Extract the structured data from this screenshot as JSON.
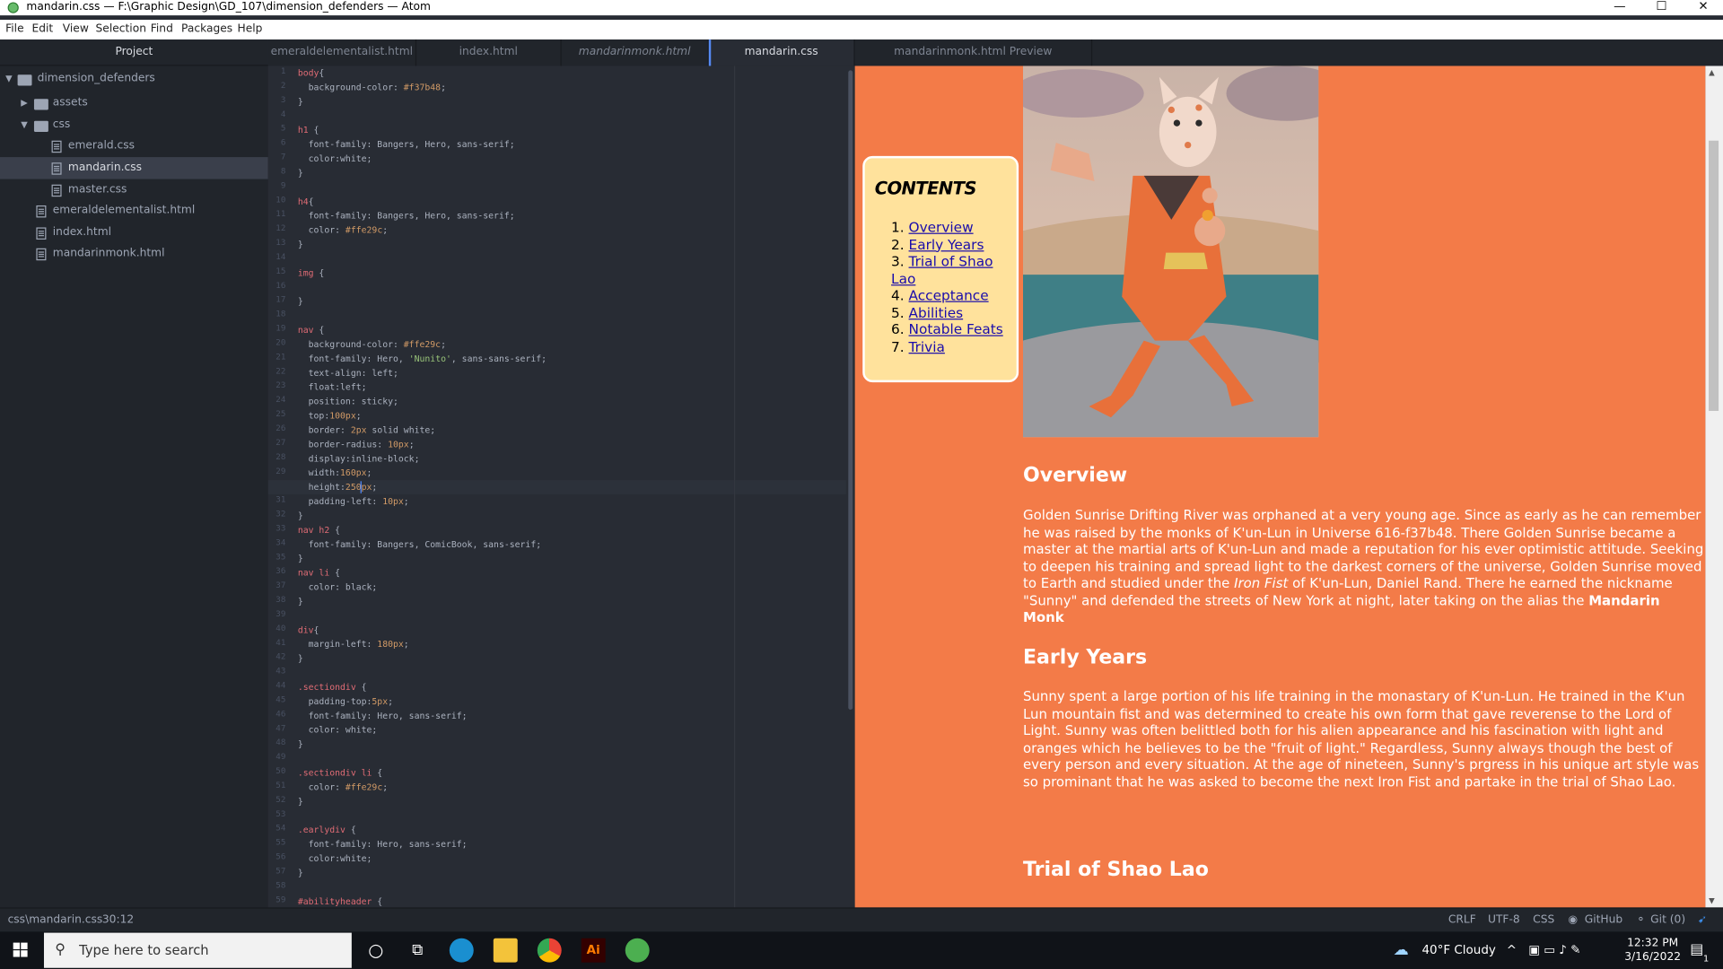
{
  "window": {
    "title": "mandarin.css — F:\\Graphic Design\\GD_107\\dimension_defenders — Atom",
    "minimize_glyph": "—",
    "maximize_glyph": "☐",
    "close_glyph": "✕"
  },
  "menu": [
    "File",
    "Edit",
    "View",
    "Selection",
    "Find",
    "Packages",
    "Help"
  ],
  "tree": {
    "header": "Project",
    "items": [
      {
        "label": "dimension_defenders",
        "type": "folder",
        "open": true,
        "depth": 0
      },
      {
        "label": "assets",
        "type": "folder",
        "open": false,
        "depth": 1
      },
      {
        "label": "css",
        "type": "folder",
        "open": true,
        "depth": 1
      },
      {
        "label": "emerald.css",
        "type": "file",
        "depth": 2
      },
      {
        "label": "mandarin.css",
        "type": "file",
        "depth": 2,
        "selected": true
      },
      {
        "label": "master.css",
        "type": "file",
        "depth": 2
      },
      {
        "label": "emeraldelementalist.html",
        "type": "file",
        "depth": 1
      },
      {
        "label": "index.html",
        "type": "file",
        "depth": 1
      },
      {
        "label": "mandarinmonk.html",
        "type": "file",
        "depth": 1
      }
    ]
  },
  "tabs": [
    {
      "label": "emeraldelementalist.html",
      "active": false,
      "italic": false
    },
    {
      "label": "index.html",
      "active": false,
      "italic": false
    },
    {
      "label": "mandarinmonk.html",
      "active": false,
      "italic": true
    },
    {
      "label": "mandarin.css",
      "active": true,
      "italic": false
    },
    {
      "label": "mandarinmonk.html Preview",
      "active": false,
      "italic": false
    }
  ],
  "editor": {
    "current_line": 30,
    "lines": [
      "body{",
      "  background-color: #f37b48;",
      "}",
      "",
      "h1 {",
      "  font-family: Bangers, Hero, sans-serif;",
      "  color:white;",
      "}",
      "",
      "h4{",
      "  font-family: Bangers, Hero, sans-serif;",
      "  color: #ffe29c;",
      "}",
      "",
      "img {",
      "",
      "}",
      "",
      "nav {",
      "  background-color: #ffe29c;",
      "  font-family: Hero, 'Nunito', sans-sans-serif;",
      "  text-align: left;",
      "  float:left;",
      "  position: sticky;",
      "  top:100px;",
      "  border: 2px solid white;",
      "  border-radius: 10px;",
      "  display:inline-block;",
      "  width:160px;",
      "  height:250px;",
      "  padding-left: 10px;",
      "}",
      "nav h2 {",
      "  font-family: Bangers, ComicBook, sans-serif;",
      "}",
      "nav li {",
      "  color: black;",
      "}",
      "",
      "div{",
      "  margin-left: 180px;",
      "}",
      "",
      ".sectiondiv {",
      "  padding-top:5px;",
      "  font-family: Hero, sans-serif;",
      "  color: white;",
      "}",
      "",
      ".sectiondiv li {",
      "  color: #ffe29c;",
      "}",
      "",
      ".earlydiv {",
      "  font-family: Hero, sans-serif;",
      "  color:white;",
      "}",
      "",
      "#abilityheader {"
    ]
  },
  "preview": {
    "nav_title": "CONTENTS",
    "nav_items": [
      "Overview",
      "Early Years",
      "Trial of Shao Lao",
      "Acceptance",
      "Abilities",
      "Notable Feats",
      "Trivia"
    ],
    "overview": {
      "heading": "Overview",
      "p1": "Golden Sunrise Drifting River was orphaned at a very young age. Since as early as he can remember he was raised by the monks of K'un-Lun in Universe 616-f37b48. There Golden Sunrise became a master at the martial arts of K'un-Lun and made a reputation for his ever optimistic attitude. Seeking to deepen his training and spread light to the darkest corners of the universe, Golden Sunrise moved to Earth and studied under the ",
      "em": "Iron Fist",
      "p2": " of K'un-Lun, Daniel Rand. There he earned the nickname \"Sunny\" and defended the streets of New York at night, later taking on the alias the ",
      "strong": "Mandarin Monk"
    },
    "early": {
      "heading": "Early Years",
      "text": "Sunny spent a large portion of his life training in the monastary of K'un-Lun. He trained in the K'un Lun mountain fist and was determined to create his own form that gave reverense to the Lord of Light. Sunny was often belittled both for his alien appearance and his fascination with light and oranges which he believes to be the \"fruit of light.\" Regardless, Sunny always though the best of every person and every situation. At the age of nineteen, Sunny's prgress in his unique art style was so prominant that he was asked to become the next Iron Fist and partake in the trial of Shao Lao."
    },
    "trial": {
      "heading": "Trial of Shao Lao"
    }
  },
  "statusbar": {
    "path": "css\\mandarin.css",
    "cursor": "30:12",
    "line_ending": "CRLF",
    "encoding": "UTF-8",
    "grammar": "CSS",
    "github": "GitHub",
    "git": "Git (0)"
  },
  "taskbar": {
    "search_placeholder": "Type here to search",
    "weather": "40°F  Cloudy",
    "time": "12:32 PM",
    "date": "3/16/2022",
    "notification_count": "1"
  },
  "colors": {
    "preview_bg": "#f37b48",
    "nav_bg": "#ffe29c",
    "editor_bg": "#282c34",
    "panel_bg": "#21252b",
    "tab_accent": "#568af2"
  }
}
